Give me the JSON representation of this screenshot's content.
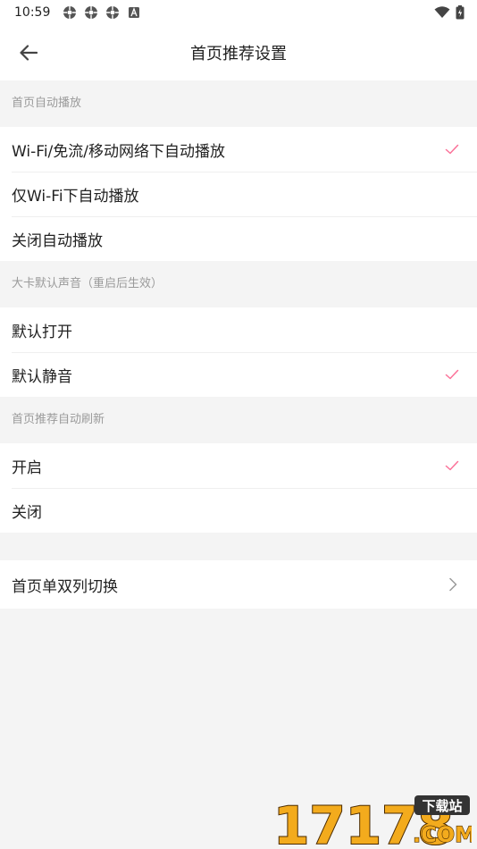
{
  "status_bar": {
    "time": "10:59",
    "notification_icons": [
      "app-icon",
      "app-icon",
      "app-icon",
      "a-icon"
    ],
    "right_icons": [
      "wifi-icon",
      "battery-icon"
    ]
  },
  "header": {
    "title": "首页推荐设置",
    "back_icon": "arrow-left-icon"
  },
  "sections": [
    {
      "label": "首页自动播放",
      "options": [
        {
          "label": "Wi-Fi/免流/移动网络下自动播放",
          "selected": true
        },
        {
          "label": "仅Wi-Fi下自动播放",
          "selected": false
        },
        {
          "label": "关闭自动播放",
          "selected": false
        }
      ]
    },
    {
      "label": "大卡默认声音（重启后生效）",
      "options": [
        {
          "label": "默认打开",
          "selected": false
        },
        {
          "label": "默认静音",
          "selected": true
        }
      ]
    },
    {
      "label": "首页推荐自动刷新",
      "options": [
        {
          "label": "开启",
          "selected": true
        },
        {
          "label": "关闭",
          "selected": false
        }
      ]
    }
  ],
  "nav_row": {
    "label": "首页单双列切换",
    "icon": "chevron-right-icon"
  },
  "colors": {
    "accent": "#fb7299",
    "background": "#f4f4f4"
  },
  "watermark": {
    "number": "17178",
    "tag": "下载站",
    "domain": ".COM"
  }
}
